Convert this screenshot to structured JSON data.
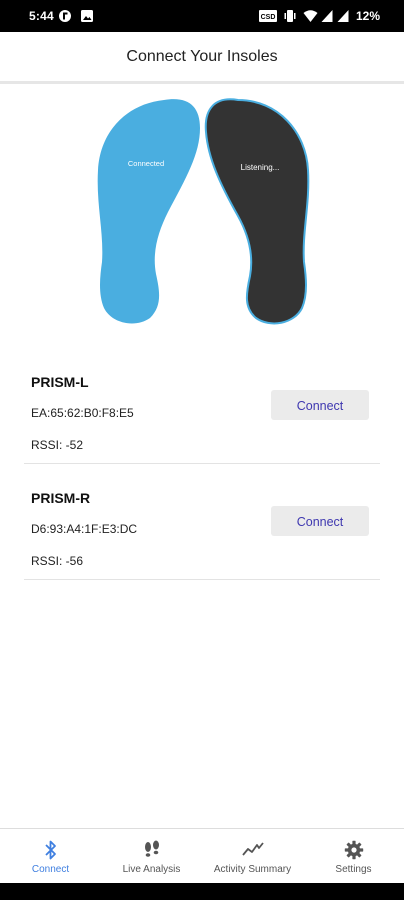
{
  "status_bar": {
    "time": "5:44",
    "battery": "12%"
  },
  "header": {
    "title": "Connect Your Insoles"
  },
  "insoles": {
    "left_status": "Connected",
    "right_status": "Listening...",
    "left_color": "#4aaee0",
    "right_color": "#333333",
    "right_outline": "#4aaee0"
  },
  "devices": [
    {
      "name": "PRISM-L",
      "mac": "EA:65:62:B0:F8:E5",
      "rssi": "RSSI: -52",
      "button": "Connect"
    },
    {
      "name": "PRISM-R",
      "mac": "D6:93:A4:1F:E3:DC",
      "rssi": "RSSI: -56",
      "button": "Connect"
    }
  ],
  "nav": {
    "items": [
      {
        "label": "Connect",
        "icon": "bluetooth-icon",
        "active": true
      },
      {
        "label": "Live Analysis",
        "icon": "footprints-icon",
        "active": false
      },
      {
        "label": "Activity Summary",
        "icon": "chart-line-icon",
        "active": false
      },
      {
        "label": "Settings",
        "icon": "gear-icon",
        "active": false
      }
    ],
    "active_color": "#3f7fe0"
  }
}
